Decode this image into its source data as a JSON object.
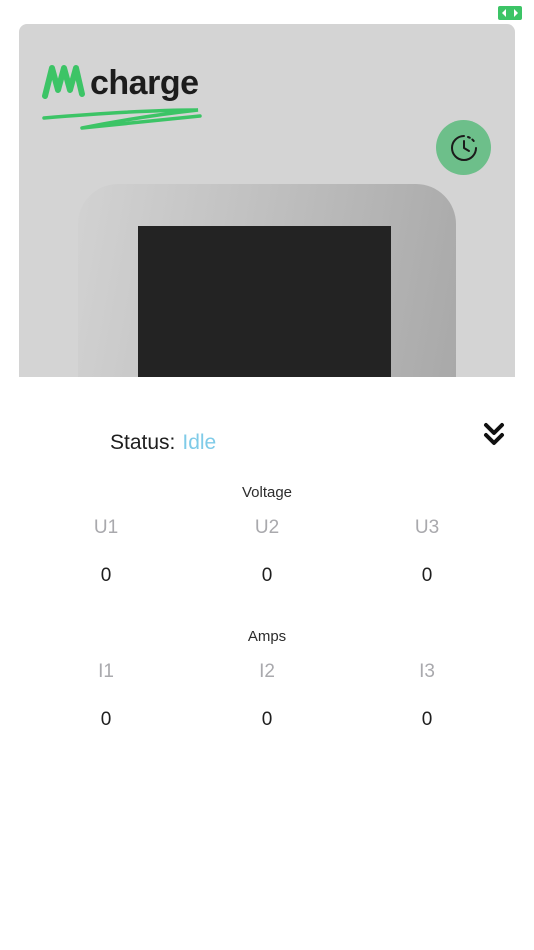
{
  "header": {
    "expand_icon": "expand-arrows-icon",
    "accent_color": "#3cc466"
  },
  "logo": {
    "mark": "W",
    "text": "charge"
  },
  "history_button": {
    "icon": "clock-history-icon",
    "color": "#6dbf8a"
  },
  "status": {
    "label": "Status:",
    "value": "Idle",
    "value_color": "#7fcbe8"
  },
  "collapse_button": {
    "icon": "double-chevron-down-icon"
  },
  "voltage": {
    "title": "Voltage",
    "phases": [
      {
        "label": "U1",
        "value": "0"
      },
      {
        "label": "U2",
        "value": "0"
      },
      {
        "label": "U3",
        "value": "0"
      }
    ]
  },
  "amps": {
    "title": "Amps",
    "phases": [
      {
        "label": "I1",
        "value": "0"
      },
      {
        "label": "I2",
        "value": "0"
      },
      {
        "label": "I3",
        "value": "0"
      }
    ]
  }
}
